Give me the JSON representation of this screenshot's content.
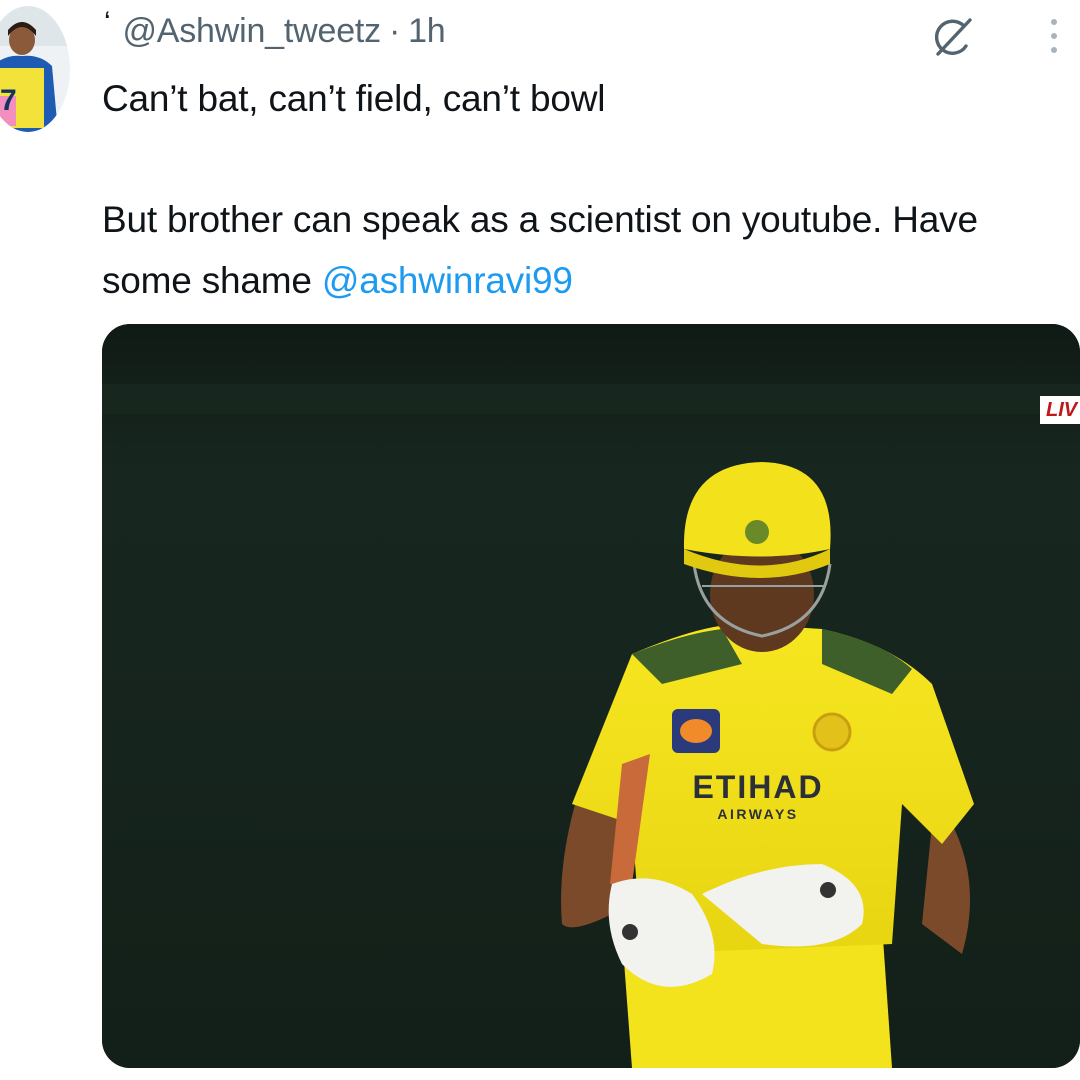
{
  "tweet": {
    "quote_mark": "‘",
    "handle": "@Ashwin_tweetz",
    "separator": "·",
    "time": "1h",
    "line1": "Can’t bat, can’t field, can’t bowl",
    "line2": "But brother can speak as a scientist on youtube. Have some shame ",
    "mention": "@ashwinravi99"
  },
  "avatar": {
    "jersey_number": "7"
  },
  "icons": {
    "grok": "grok-icon",
    "more": "more-vertical-icon"
  },
  "media": {
    "live_badge": "LIV",
    "sponsor_main": "ETIHAD",
    "sponsor_sub": "AIRWAYS"
  },
  "colors": {
    "mention": "#1d9bf0",
    "secondary_text": "#536471",
    "jersey_yellow": "#f4e21c"
  }
}
